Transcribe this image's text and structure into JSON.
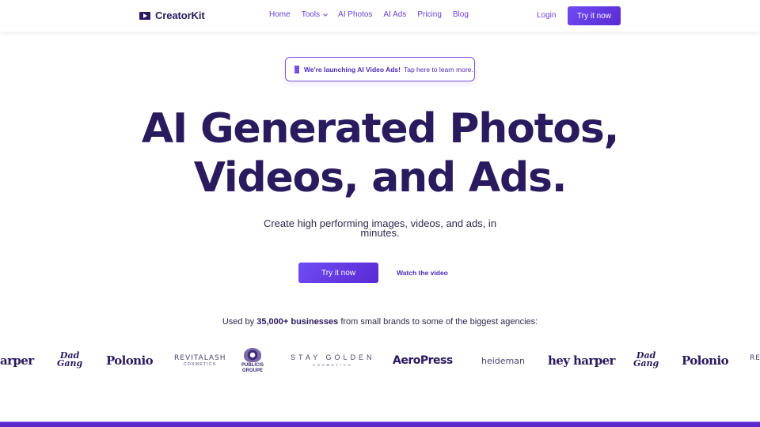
{
  "header": {
    "logo_text": "CreatorKit",
    "nav": [
      {
        "label": "Home",
        "has_dropdown": false
      },
      {
        "label": "Tools",
        "has_dropdown": true
      },
      {
        "label": "AI Photos",
        "has_dropdown": false
      },
      {
        "label": "AI Ads",
        "has_dropdown": false
      },
      {
        "label": "Pricing",
        "has_dropdown": false
      },
      {
        "label": "Blog",
        "has_dropdown": false
      }
    ],
    "login_label": "Login",
    "cta_label": "Try it now"
  },
  "banner": {
    "icon": "film-strip-icon",
    "strong_text": "We're launching AI Video Ads!",
    "link_text": "Tap here to learn more."
  },
  "hero": {
    "title_line1": "AI Generated Photos,",
    "title_line2": "Videos, and Ads.",
    "subtitle": "Create high performing images, videos, and ads, in minutes.",
    "primary_cta": "Try it now",
    "secondary_cta": "Watch the video"
  },
  "social_proof": {
    "prefix": "Used by ",
    "highlight": "35,000+ businesses",
    "suffix": " from small brands to some of the biggest agencies:"
  },
  "logos": {
    "hey_harper_partial": "arper",
    "dad_gang_1": "Dad",
    "dad_gang_2": "Gang",
    "polonio": "Polonio",
    "revitalash_1": "REVITALASH",
    "revitalash_2": "COSMETICS",
    "publicis_1": "PUBLICIS",
    "publicis_2": "GROUPE",
    "stay_golden_1": "STAY GOLDEN",
    "stay_golden_2": "COSMETICS",
    "aeropress": "AeroPress",
    "heideman": "heideman",
    "hey_harper": "hey harper",
    "revitalash_partial": "RE"
  },
  "colors": {
    "brand_dark": "#2a1a5e",
    "accent": "#6a3fd8",
    "bottom_bar": "#5b28cc"
  }
}
